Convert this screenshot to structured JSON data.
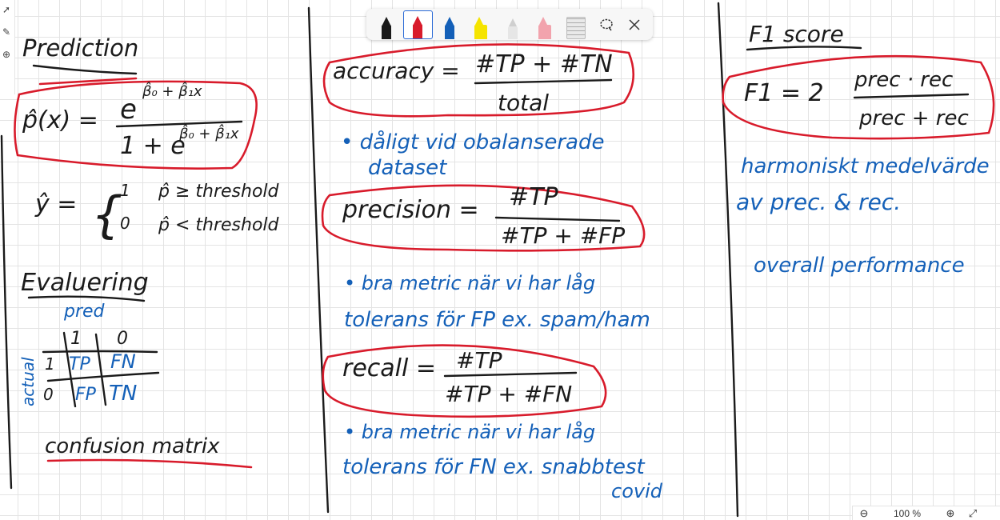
{
  "toolbar": {
    "tools": [
      {
        "name": "black-pen",
        "color": "#1a1a1a",
        "selected": false
      },
      {
        "name": "red-pen",
        "color": "#d81b2b",
        "selected": true
      },
      {
        "name": "blue-pen",
        "color": "#1460b8",
        "selected": false
      },
      {
        "name": "yellow-highlighter",
        "color": "#f5e400",
        "selected": false
      },
      {
        "name": "eraser",
        "color": "#e6e6e6",
        "selected": false
      },
      {
        "name": "pink-highlighter",
        "color": "#f2a3ad",
        "selected": false
      },
      {
        "name": "ruler",
        "color": "#cfcfcf",
        "selected": false
      }
    ],
    "lasso_icon": "lasso-icon",
    "close_icon": "close-icon"
  },
  "zoom": {
    "zoom_out_icon": "⊖",
    "value": "100 %",
    "zoom_in_icon": "⊕",
    "fit_icon": "⤢"
  },
  "notes": {
    "col1": {
      "heading_prediction": "Prediction",
      "phat": "p̂(x) =",
      "num_e": "e",
      "num_exp": "β̂₀ + β̂₁x",
      "den": "1 + e",
      "den_exp": "β̂₀ + β̂₁x",
      "yhat": "ŷ =",
      "case1_val": "1",
      "case1_cond": "p̂ ≥ threshold",
      "case2_val": "0",
      "case2_cond": "p̂ < threshold",
      "heading_eval": "Evaluering",
      "pred": "pred",
      "col1_label": "1",
      "col0_label": "0",
      "actual": "actual",
      "row1_label": "1",
      "row0_label": "0",
      "tp": "TP",
      "fn": "FN",
      "fp": "FP",
      "tn": "TN",
      "confusion": "confusion matrix"
    },
    "col2": {
      "accuracy_lhs": "accuracy =",
      "accuracy_num": "#TP + #TN",
      "accuracy_den": "total",
      "note1_line1": "• dåligt vid obalanserade",
      "note1_line2": "dataset",
      "precision_lhs": "precision =",
      "precision_num": "#TP",
      "precision_den": "#TP + #FP",
      "note2_line1": "• bra metric när vi har låg",
      "note2_line2": "tolerans för FP ex. spam/ham",
      "recall_lhs": "recall =",
      "recall_num": "#TP",
      "recall_den": "#TP + #FN",
      "note3_line1": "• bra metric när vi har låg",
      "note3_line2": "tolerans för FN ex. snabbtest",
      "note3_line3": "covid"
    },
    "col3": {
      "heading_f1": "F1 score",
      "f1_lhs": "F1 = 2",
      "f1_num": "prec · rec",
      "f1_den": "prec + rec",
      "note_line1": "harmoniskt medelvärde",
      "note_line2": "av prec. & rec.",
      "note_line3": "overall performance"
    }
  }
}
